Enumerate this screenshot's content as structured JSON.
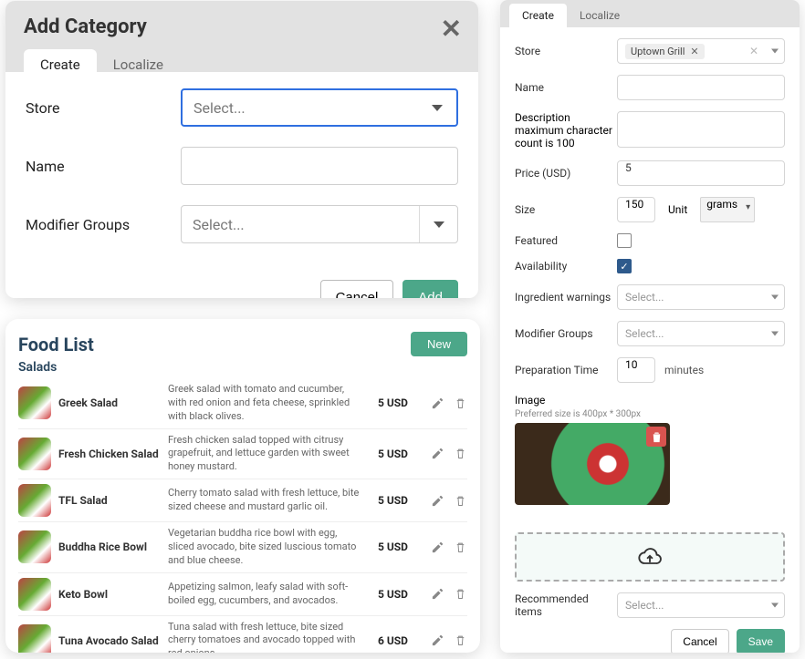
{
  "addCategory": {
    "title": "Add Category",
    "tabs": {
      "create": "Create",
      "localize": "Localize"
    },
    "fields": {
      "store_label": "Store",
      "store_placeholder": "Select...",
      "name_label": "Name",
      "modgroups_label": "Modifier Groups",
      "modgroups_placeholder": "Select..."
    },
    "actions": {
      "cancel": "Cancel",
      "add": "Add"
    }
  },
  "foodList": {
    "title": "Food List",
    "subtitle": "Salads",
    "new_label": "New",
    "items": [
      {
        "name": "Greek Salad",
        "desc": "Greek salad with tomato and cucumber, with red onion and feta cheese, sprinkled with black olives.",
        "price": "5 USD"
      },
      {
        "name": "Fresh Chicken Salad",
        "desc": "Fresh chicken salad topped with citrusy grapefruit, and lettuce garden with sweet honey mustard.",
        "price": "5 USD"
      },
      {
        "name": "TFL Salad",
        "desc": "Cherry tomato salad with fresh lettuce, bite sized cheese and mustard garlic oil.",
        "price": "5 USD"
      },
      {
        "name": "Buddha Rice Bowl",
        "desc": "Vegetarian buddha rice bowl with egg, sliced avocado, bite sized luscious tomato and blue cheese.",
        "price": "5 USD"
      },
      {
        "name": "Keto Bowl",
        "desc": "Appetizing salmon, leafy salad with soft-boiled egg, cucumbers, and avocados.",
        "price": "5 USD"
      },
      {
        "name": "Tuna Avocado Salad",
        "desc": "Tuna salad with fresh lettuce, bite sized cherry tomatoes and avocado topped with red onions.",
        "price": "6 USD"
      }
    ]
  },
  "itemForm": {
    "tabs": {
      "create": "Create",
      "localize": "Localize"
    },
    "store_label": "Store",
    "store_value": "Uptown Grill",
    "name_label": "Name",
    "desc_label": "Description",
    "desc_hint": "maximum character count is 100",
    "price_label": "Price (USD)",
    "price_value": "5",
    "size_label": "Size",
    "size_value": "150",
    "unit_label": "Unit",
    "unit_value": "grams",
    "featured_label": "Featured",
    "availability_label": "Availability",
    "ingredient_label": "Ingredient warnings",
    "ingredient_placeholder": "Select...",
    "modgroups_label": "Modifier Groups",
    "modgroups_placeholder": "Select...",
    "prep_label": "Preparation Time",
    "prep_value": "10",
    "prep_unit": "minutes",
    "image_label": "Image",
    "image_hint": "Preferred size is 400px * 300px",
    "recommended_label": "Recommended items",
    "recommended_placeholder": "Select...",
    "actions": {
      "cancel": "Cancel",
      "save": "Save"
    }
  }
}
